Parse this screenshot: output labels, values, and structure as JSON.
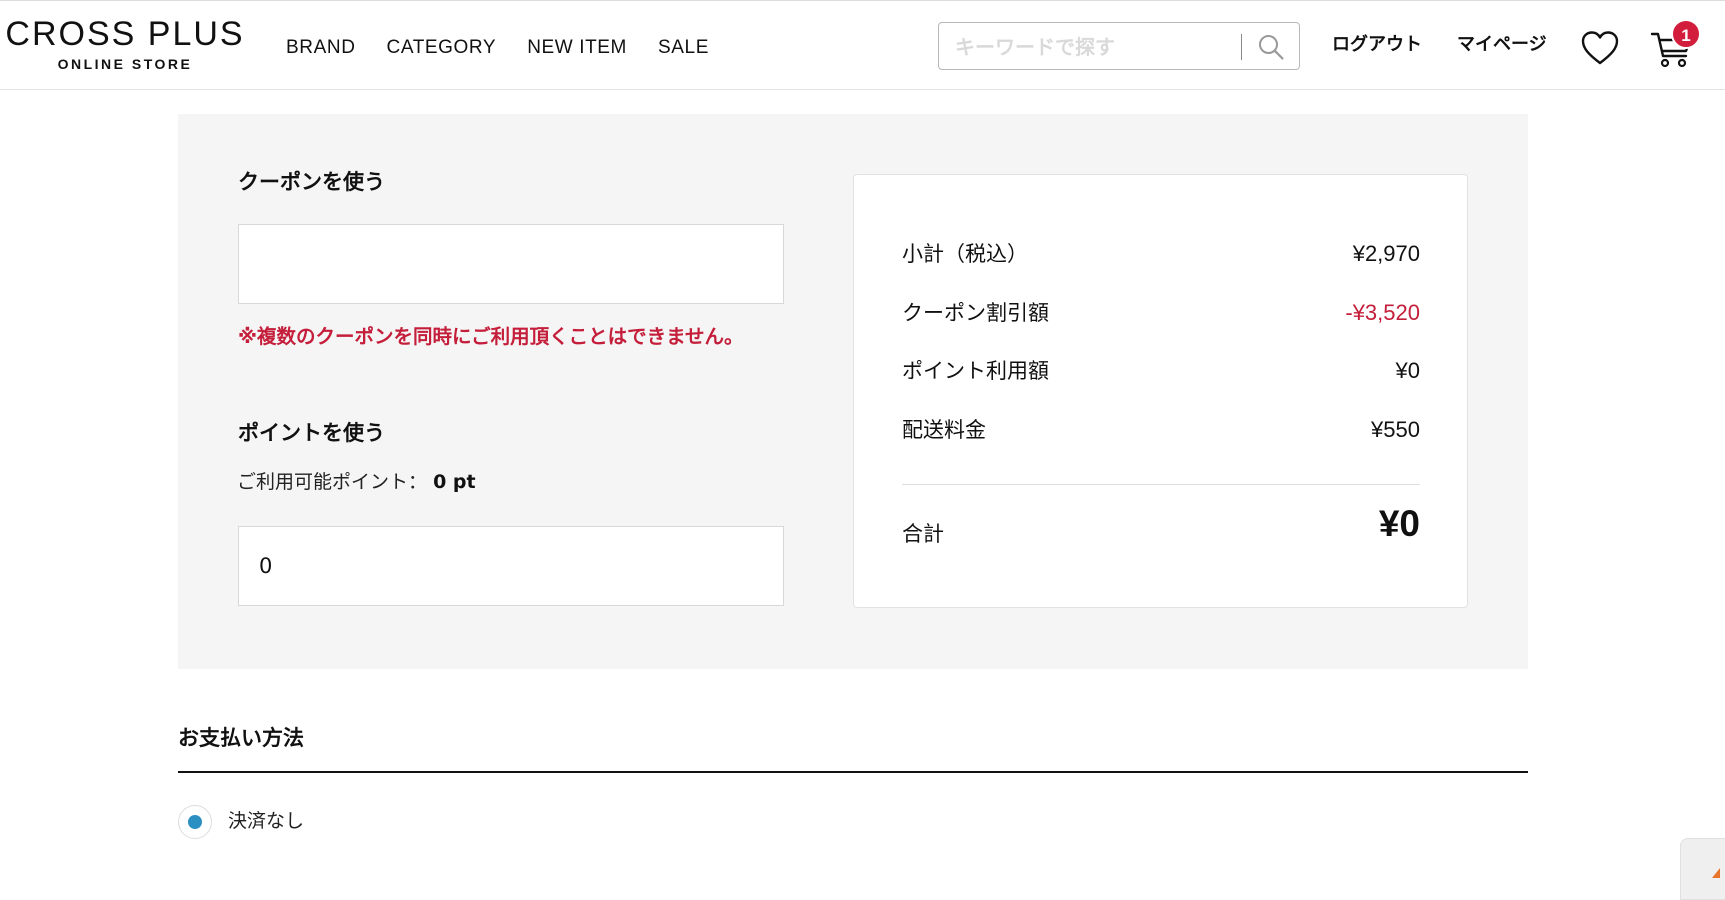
{
  "header": {
    "logo_main": "CROSS PLUS",
    "logo_sub": "ONLINE STORE",
    "nav": [
      "BRAND",
      "CATEGORY",
      "NEW ITEM",
      "SALE"
    ],
    "search_placeholder": "キーワードで探す",
    "logout": "ログアウト",
    "mypage": "マイページ",
    "cart_count": "1",
    "icons": [
      "search-icon",
      "heart-icon",
      "cart-icon"
    ]
  },
  "coupon": {
    "title": "クーポンを使う",
    "value": "",
    "warning": "※複数のクーポンを同時にご利用頂くことはできません。"
  },
  "points": {
    "title": "ポイントを使う",
    "available_label": "ご利用可能ポイント：",
    "available_value": "0 pt",
    "value": "0"
  },
  "summary": {
    "subtotal_label": "小計（税込）",
    "subtotal_value": "¥2,970",
    "coupon_label": "クーポン割引額",
    "coupon_value": "-¥3,520",
    "points_label": "ポイント利用額",
    "points_value": "¥0",
    "shipping_label": "配送料金",
    "shipping_value": "¥550",
    "total_label": "合計",
    "total_value": "¥0"
  },
  "payment": {
    "title": "お支払い方法",
    "options": [
      {
        "label": "決済なし",
        "selected": true
      }
    ]
  },
  "colors": {
    "accent_red": "#c41e3a",
    "badge_red": "#d21e3c",
    "radio_blue": "#2b8fc2",
    "panel_gray": "#f5f5f5"
  }
}
